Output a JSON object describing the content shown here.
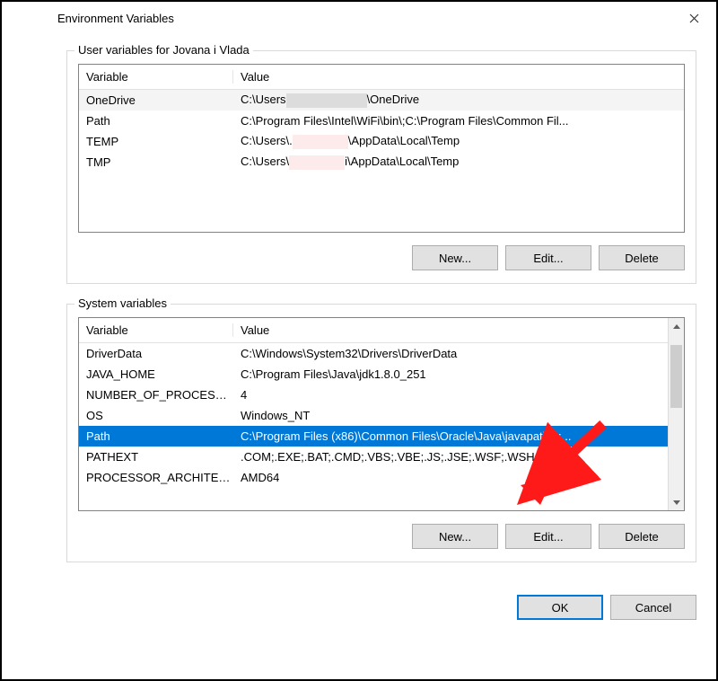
{
  "dialog": {
    "title": "Environment Variables"
  },
  "user_section": {
    "legend": "User variables for Jovana i Vlada",
    "header_variable": "Variable",
    "header_value": "Value",
    "rows": [
      {
        "variable": "OneDrive",
        "value_before": "C:\\Users",
        "value_after": "\\OneDrive"
      },
      {
        "variable": "Path",
        "value": "C:\\Program Files\\Intel\\WiFi\\bin\\;C:\\Program Files\\Common Fil..."
      },
      {
        "variable": "TEMP",
        "value_before": "C:\\Users\\.",
        "value_after": "\\AppData\\Local\\Temp"
      },
      {
        "variable": "TMP",
        "value_before": "C:\\Users\\",
        "value_after": "i\\AppData\\Local\\Temp"
      }
    ],
    "buttons": {
      "new": "New...",
      "edit": "Edit...",
      "delete": "Delete"
    }
  },
  "system_section": {
    "legend": "System variables",
    "header_variable": "Variable",
    "header_value": "Value",
    "rows": [
      {
        "variable": "DriverData",
        "value": "C:\\Windows\\System32\\Drivers\\DriverData",
        "selected": false
      },
      {
        "variable": "JAVA_HOME",
        "value": "C:\\Program Files\\Java\\jdk1.8.0_251",
        "selected": false
      },
      {
        "variable": "NUMBER_OF_PROCESSORS",
        "value": "4",
        "selected": false
      },
      {
        "variable": "OS",
        "value": "Windows_NT",
        "selected": false
      },
      {
        "variable": "Path",
        "value": "C:\\Program Files (x86)\\Common Files\\Oracle\\Java\\javapath;c:...",
        "selected": true
      },
      {
        "variable": "PATHEXT",
        "value": ".COM;.EXE;.BAT;.CMD;.VBS;.VBE;.JS;.JSE;.WSF;.WSH;.MSC",
        "selected": false
      },
      {
        "variable": "PROCESSOR_ARCHITECTU...",
        "value": "AMD64",
        "selected": false
      }
    ],
    "buttons": {
      "new": "New...",
      "edit": "Edit...",
      "delete": "Delete"
    }
  },
  "dialog_buttons": {
    "ok": "OK",
    "cancel": "Cancel"
  }
}
